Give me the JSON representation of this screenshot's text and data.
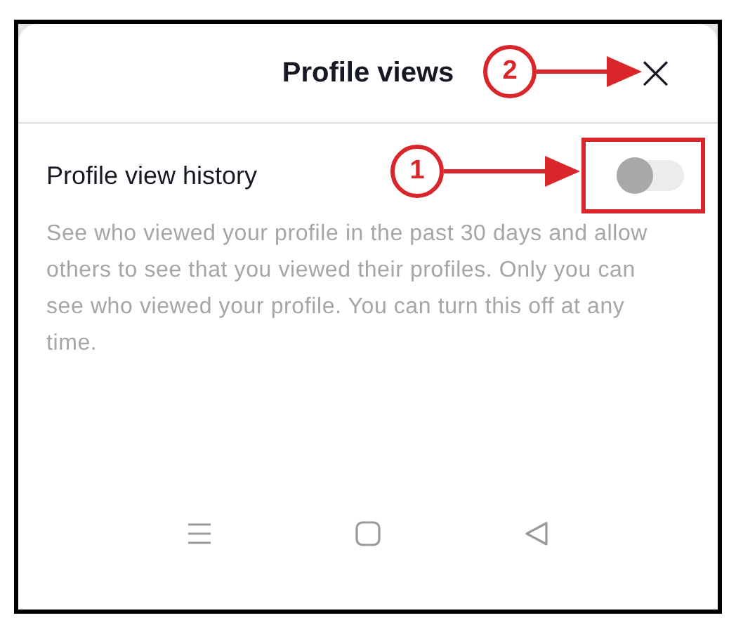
{
  "header": {
    "title": "Profile views",
    "close": "×"
  },
  "setting": {
    "label": "Profile view history",
    "on": false,
    "description": "See who viewed your profile in the past 30 days and allow others to see that you viewed their profiles. Only you can see who viewed your profile. You can turn this off at any time."
  },
  "annotations": [
    {
      "label": "1",
      "highlight": true
    },
    {
      "label": "2"
    }
  ],
  "nav_bar": [
    {
      "kind": "menu"
    },
    {
      "kind": "home"
    },
    {
      "kind": "back"
    }
  ]
}
